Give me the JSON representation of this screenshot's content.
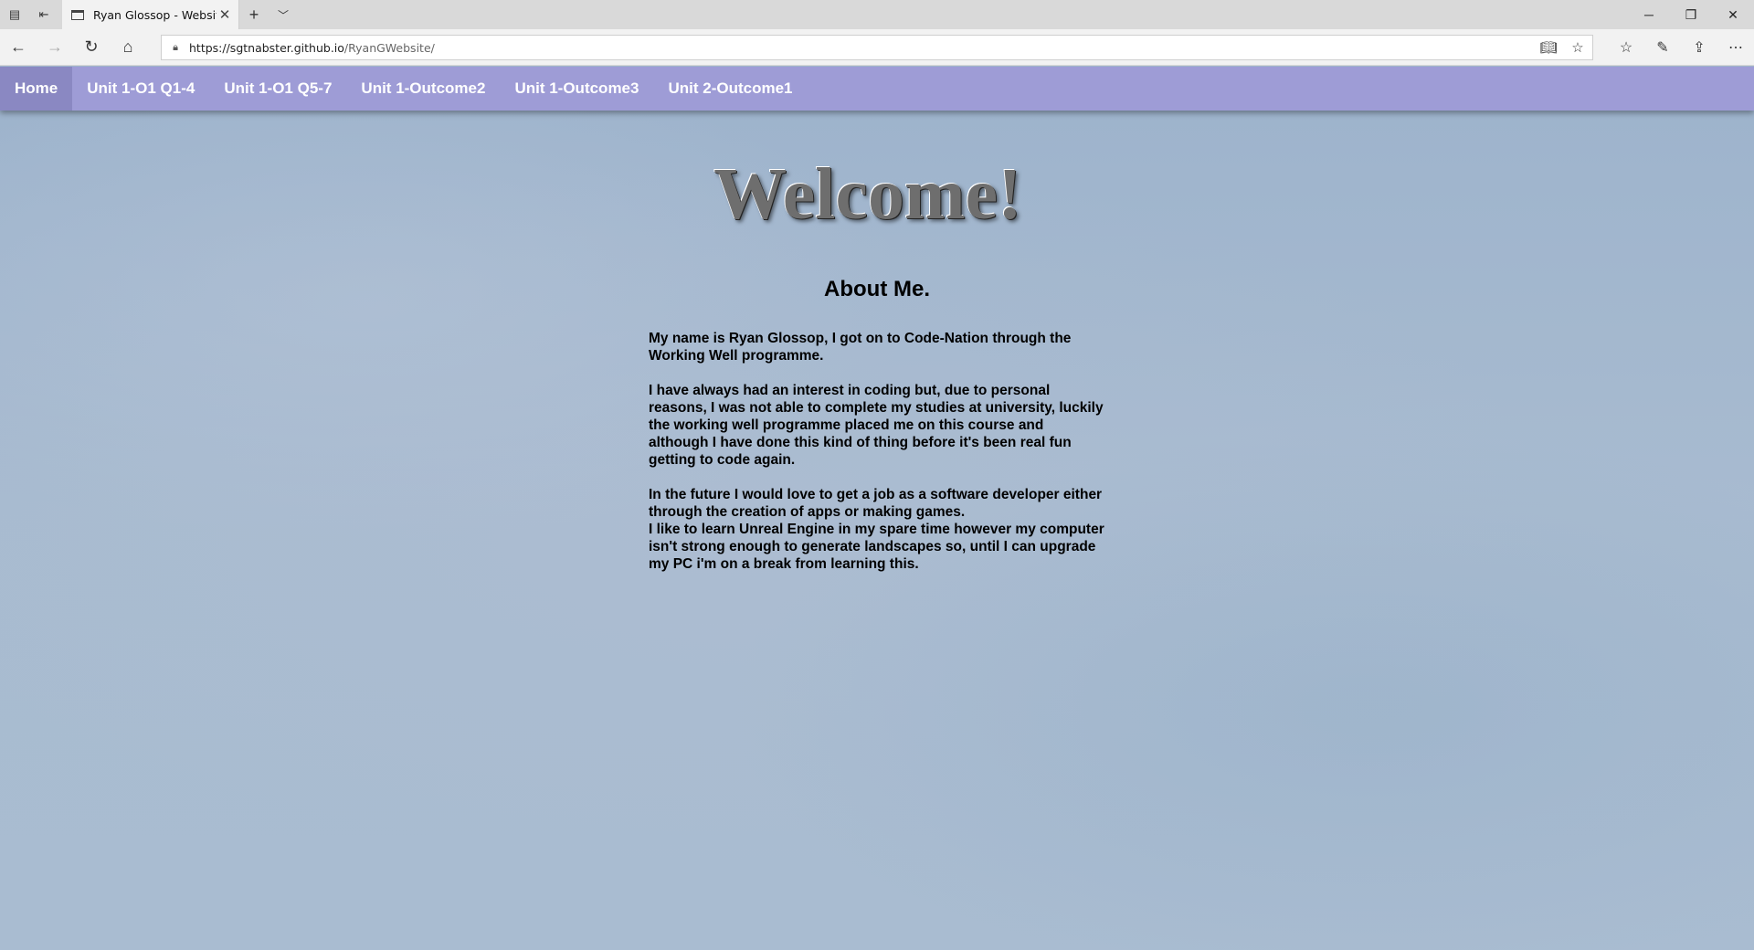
{
  "browser": {
    "tab_title": "Ryan Glossop - Website",
    "url_host": "https://sgtnabster.github.io",
    "url_path": "/RyanGWebsite/",
    "icons": {
      "tabs_aside": "tabs-aside-icon",
      "set_aside": "set-aside-icon",
      "new_tab": "plus-icon",
      "tab_list": "chevron-down-icon",
      "back": "arrow-left-icon",
      "forward": "arrow-right-icon",
      "refresh": "refresh-icon",
      "home": "home-icon",
      "lock": "lock-icon",
      "reading_view": "book-icon",
      "favorite": "star-icon",
      "favorites_hub": "favorites-list-icon",
      "notes": "pen-icon",
      "share": "share-icon",
      "more": "ellipsis-icon"
    }
  },
  "site": {
    "nav": [
      {
        "label": "Home",
        "active": true
      },
      {
        "label": "Unit 1-O1 Q1-4"
      },
      {
        "label": "Unit 1-O1 Q5-7"
      },
      {
        "label": "Unit 1-Outcome2"
      },
      {
        "label": "Unit 1-Outcome3"
      },
      {
        "label": "Unit 2-Outcome1"
      }
    ],
    "welcome": "Welcome!",
    "about_title": "About Me.",
    "paragraphs": [
      "My name is Ryan Glossop, I got on to Code-Nation through the Working Well programme.",
      "I have always had an interest in coding but, due to personal reasons, I was not able to complete my studies at university, luckily the working well programme placed me on this course and although I have done this kind of thing before it's been real fun getting to code again.",
      "In the future I would love to get a job as a software developer either through the creation of apps or making games.",
      "I like to learn Unreal Engine in my spare time however my computer isn't strong enough to generate landscapes so, until I can upgrade my PC i'm on a break from learning this."
    ]
  }
}
